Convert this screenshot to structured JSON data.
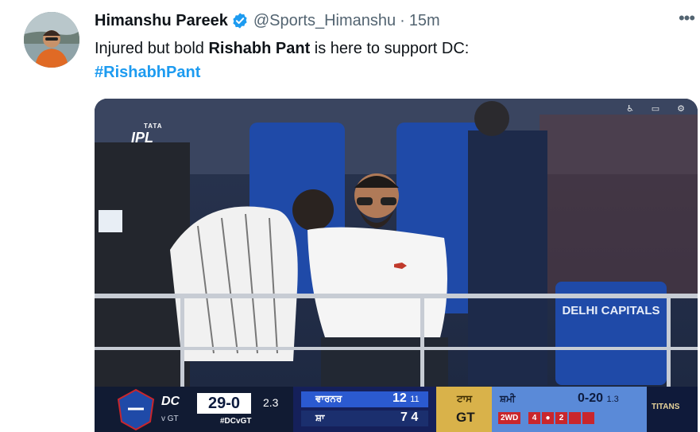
{
  "author": {
    "name": "Himanshu Pareek",
    "handle": "@Sports_Himanshu",
    "separator": "·",
    "time": "15m"
  },
  "tweet": {
    "text_before": "Injured but bold ",
    "bold_name": "Rishabh Pant",
    "text_after": " is here to support DC:",
    "hashtag": "#RishabhPant"
  },
  "menu": {
    "more_label": "•••"
  },
  "media": {
    "logo": {
      "brand": "IPL",
      "sponsor": "TATA"
    },
    "banner_text": "DELHI CAPITALS",
    "scoreboard": {
      "team": "DC",
      "opponent": "v GT",
      "score": "29-0",
      "overs": "2.3",
      "hashtag": "#DCvGT",
      "batter1": "ਵਾਰਨਰ",
      "batter1_runs": "12",
      "batter1_balls": "11",
      "batter2": "ਸ਼ਾ",
      "batter2_runs": "7",
      "batter2_balls": "4",
      "toss_label": "ਟਾਸ",
      "toss_winner": "GT",
      "bowler": "ਸ਼ਮੀ",
      "bowler_figures": "0-20",
      "bowler_overs": "1.3",
      "extra_label": "2WD",
      "balls": [
        "4",
        "●",
        "2",
        "",
        ""
      ],
      "opponent_logo": "TITANS"
    }
  },
  "colors": {
    "link": "#1d9bf0",
    "verified": "#1d9bf0",
    "muted": "#536471"
  }
}
